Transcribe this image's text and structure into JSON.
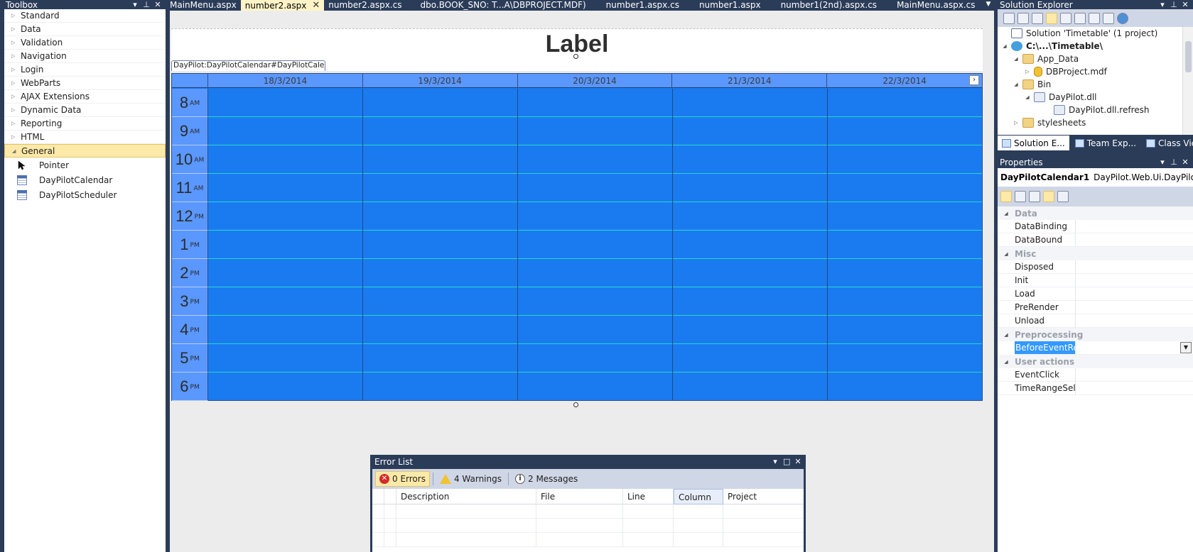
{
  "toolbox": {
    "title": "Toolbox",
    "categories": [
      "Standard",
      "Data",
      "Validation",
      "Navigation",
      "Login",
      "WebParts",
      "AJAX Extensions",
      "Dynamic Data",
      "Reporting",
      "HTML",
      "General"
    ],
    "items": [
      "Pointer",
      "DayPilotCalendar",
      "DayPilotScheduler"
    ]
  },
  "tabs": [
    "MainMenu.aspx",
    "number2.aspx",
    "number2.aspx.cs",
    "dbo.BOOK_SNO: T...A\\DBPROJECT.MDF)",
    "number1.aspx.cs",
    "number1.aspx",
    "number1(2nd).aspx.cs",
    "MainMenu.aspx.cs"
  ],
  "designer": {
    "label_text": "Label",
    "control_tag": "DayPilot:DayPilotCalendar#DayPilotCalen...",
    "days": [
      "18/3/2014",
      "19/3/2014",
      "20/3/2014",
      "21/3/2014",
      "22/3/2014"
    ],
    "hours": [
      {
        "n": "8",
        "ap": "AM"
      },
      {
        "n": "9",
        "ap": "AM"
      },
      {
        "n": "10",
        "ap": "AM"
      },
      {
        "n": "11",
        "ap": "AM"
      },
      {
        "n": "12",
        "ap": "PM"
      },
      {
        "n": "1",
        "ap": "PM"
      },
      {
        "n": "2",
        "ap": "PM"
      },
      {
        "n": "3",
        "ap": "PM"
      },
      {
        "n": "4",
        "ap": "PM"
      },
      {
        "n": "5",
        "ap": "PM"
      },
      {
        "n": "6",
        "ap": "PM"
      }
    ],
    "calendar_color": "#1a7bf0",
    "header_color": "#5a97ff"
  },
  "error_list": {
    "title": "Error List",
    "errors": "0 Errors",
    "warnings": "4 Warnings",
    "messages": "2 Messages",
    "columns": [
      "Description",
      "File",
      "Line",
      "Column",
      "Project"
    ]
  },
  "solution_explorer": {
    "title": "Solution Explorer",
    "nodes": [
      "Solution 'Timetable' (1 project)",
      "C:\\...\\Timetable\\",
      "App_Data",
      "DBProject.mdf",
      "Bin",
      "DayPilot.dll",
      "DayPilot.dll.refresh",
      "stylesheets"
    ],
    "tabs": [
      "Solution E...",
      "Team Exp...",
      "Class View"
    ]
  },
  "properties": {
    "title": "Properties",
    "object_name": "DayPilotCalendar1",
    "object_type": "DayPilot.Web.Ui.DayPilotCa",
    "categories": [
      "Data",
      "Misc",
      "Preprocessing",
      "User actions"
    ],
    "rows": [
      "DataBinding",
      "DataBound",
      "Disposed",
      "Init",
      "Load",
      "PreRender",
      "Unload",
      "BeforeEventRend",
      "EventClick",
      "TimeRangeSelec"
    ]
  }
}
